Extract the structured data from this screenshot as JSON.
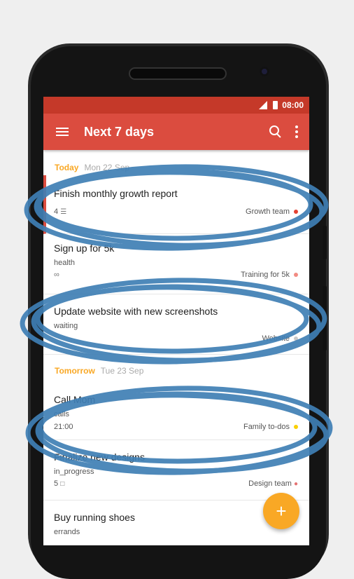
{
  "status": {
    "time": "08:00"
  },
  "appbar": {
    "title": "Next 7 days",
    "icons": [
      "menu-icon",
      "search-icon",
      "more-vert-icon"
    ]
  },
  "sections": [
    {
      "name": "Today",
      "date": "Mon 22 Sep"
    },
    {
      "name": "Tomorrow",
      "date": "Tue 23 Sep"
    }
  ],
  "tasks": [
    {
      "title": "Finish monthly growth report",
      "comments": "4",
      "project": "Growth team",
      "project_color": "#e44232"
    },
    {
      "title": "Sign up for 5k",
      "label": "health",
      "project": "Training for 5k",
      "project_color": "#f28b82"
    },
    {
      "title": "Update website with new screenshots",
      "label": "waiting",
      "project": "Website"
    },
    {
      "title": "Call Mom",
      "label": "calls",
      "time": "21:00",
      "project": "Family to-dos",
      "project_color": "#fad000"
    },
    {
      "title": "Finalize new designs",
      "label": "in_progress",
      "comments": "5",
      "project": "Design team"
    },
    {
      "title": "Buy running shoes",
      "label": "errands"
    }
  ],
  "fab": {
    "label": "+"
  },
  "colors": {
    "primary": "#db4c3f",
    "status_bar": "#c53929",
    "accent": "#f9a825",
    "scribble": "#3f7fb5"
  }
}
